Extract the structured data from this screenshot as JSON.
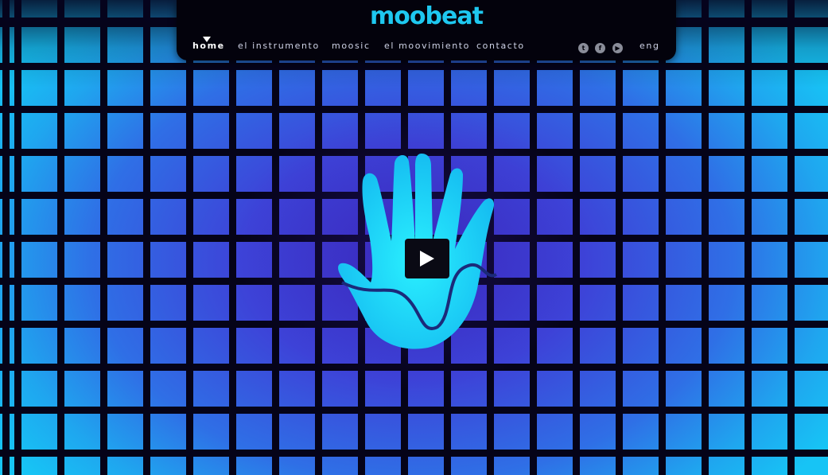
{
  "brand": {
    "logo_text": "moobeat",
    "logo_color": "#1ec8f0"
  },
  "nav": {
    "items": [
      {
        "label": "home",
        "active": true
      },
      {
        "label": "el instrumento",
        "active": false
      },
      {
        "label": "moosic",
        "active": false
      },
      {
        "label": "el moovimiento",
        "active": false
      },
      {
        "label": "contacto",
        "active": false
      }
    ]
  },
  "social": {
    "icons": [
      "twitter-icon",
      "facebook-icon",
      "youtube-icon"
    ]
  },
  "language": {
    "label": "eng"
  },
  "hero": {
    "video_state": "paused",
    "play_icon": "play-icon",
    "hand_color": "#19c8f5"
  },
  "colors": {
    "topbar": "#03020c",
    "grid_center": "#3a2fc4",
    "grid_edge": "#17c4f5",
    "accent": "#1ec8f0"
  }
}
